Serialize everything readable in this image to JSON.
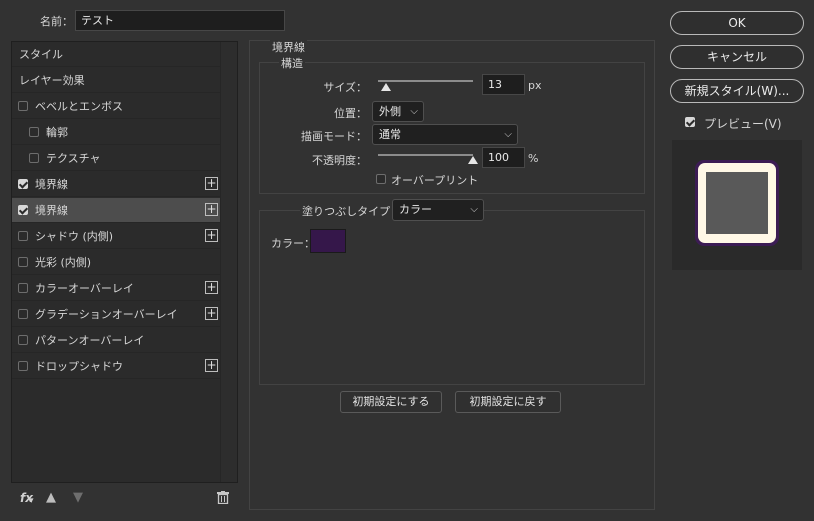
{
  "name_label": "名前：",
  "name_value": "テスト",
  "styles_list": {
    "header_styles": "スタイル",
    "header_blending": "レイヤー効果",
    "items": [
      {
        "label": "ベベルとエンボス",
        "checked": false,
        "indent": false,
        "plus": false
      },
      {
        "label": "輪郭",
        "checked": false,
        "indent": true,
        "plus": false
      },
      {
        "label": "テクスチャ",
        "checked": false,
        "indent": true,
        "plus": false
      },
      {
        "label": "境界線",
        "checked": true,
        "indent": false,
        "plus": true
      },
      {
        "label": "境界線",
        "checked": true,
        "indent": false,
        "plus": true,
        "selected": true
      },
      {
        "label": "シャドウ (内側)",
        "checked": false,
        "indent": false,
        "plus": true
      },
      {
        "label": "光彩 (内側)",
        "checked": false,
        "indent": false,
        "plus": false
      },
      {
        "label": "カラーオーバーレイ",
        "checked": false,
        "indent": false,
        "plus": true
      },
      {
        "label": "グラデーションオーバーレイ",
        "checked": false,
        "indent": false,
        "plus": true
      },
      {
        "label": "パターンオーバーレイ",
        "checked": false,
        "indent": false,
        "plus": false
      },
      {
        "label": "ドロップシャドウ",
        "checked": false,
        "indent": false,
        "plus": true
      }
    ],
    "plus_glyph": "+",
    "bottom_fx": "fx"
  },
  "stroke": {
    "section_title": "境界線",
    "structure_title": "構造",
    "size_label": "サイズ：",
    "size_value": "13",
    "size_unit": "px",
    "size_slider_fraction": 0.08,
    "position_label": "位置：",
    "position_value": "外側",
    "blend_label": "描画モード：",
    "blend_value": "通常",
    "opacity_label": "不透明度：",
    "opacity_value": "100",
    "opacity_unit": "%",
    "opacity_slider_fraction": 1.0,
    "overprint_label": "オーバープリント",
    "fill_type_label": "塗りつぶしタイプ：",
    "fill_type_value": "カラー",
    "color_label": "カラー：",
    "color_value": "#35174a",
    "make_default_label": "初期設定にする",
    "reset_default_label": "初期設定に戻す"
  },
  "right": {
    "ok_label": "OK",
    "cancel_label": "キャンセル",
    "new_style_label": "新規スタイル(W)...",
    "preview_label": "プレビュー(V)",
    "preview_checked": true
  },
  "colors": {
    "preview_outer": "#3c1c54",
    "preview_inner": "#fff8e6",
    "preview_fill": "#595959"
  }
}
